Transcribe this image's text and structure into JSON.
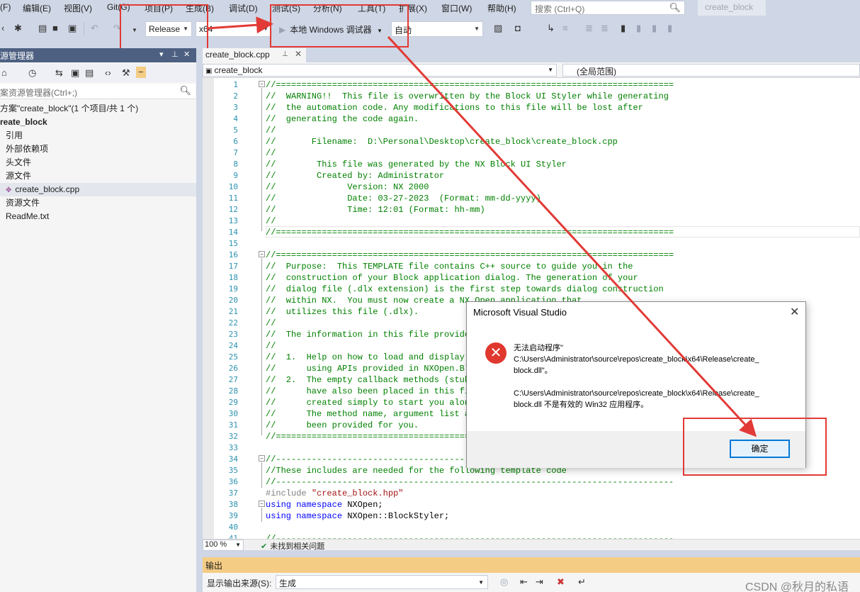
{
  "menu": [
    "(F)",
    "编辑(E)",
    "视图(V)",
    "Git(G)",
    "项目(P)",
    "生成(B)",
    "调试(D)",
    "测试(S)",
    "分析(N)",
    "工具(T)",
    "扩展(X)",
    "窗口(W)",
    "帮助(H)"
  ],
  "search": {
    "placeholder": "搜索 (Ctrl+Q)"
  },
  "project_title": "create_block",
  "toolbar": {
    "config": "Release",
    "platform": "x64",
    "run_label": "本地 Windows 调试器",
    "run_mode": "自动"
  },
  "solution_explorer": {
    "title": "源管理器",
    "search_placeholder": "案资源管理器(Ctrl+;)",
    "items": [
      {
        "label": "方案\"create_block\"(1 个项目/共 1 个)"
      },
      {
        "label": "reate_block"
      },
      {
        "label": "引用"
      },
      {
        "label": "外部依赖项"
      },
      {
        "label": "头文件"
      },
      {
        "label": "源文件"
      },
      {
        "label": "create_block.cpp"
      },
      {
        "label": "资源文件"
      },
      {
        "label": "ReadMe.txt"
      }
    ]
  },
  "editor": {
    "tab": "create_block.cpp",
    "nav_left": "create_block",
    "nav_right": "(全局范围)",
    "line_numbers": [
      "1",
      "2",
      "3",
      "4",
      "5",
      "6",
      "7",
      "8",
      "9",
      "10",
      "11",
      "12",
      "13",
      "14",
      "15",
      "16",
      "17",
      "18",
      "19",
      "20",
      "21",
      "22",
      "23",
      "24",
      "25",
      "26",
      "27",
      "28",
      "29",
      "30",
      "31",
      "32",
      "33",
      "34",
      "35",
      "36",
      "37",
      "38",
      "39",
      "40",
      "41"
    ],
    "lines": {
      "l1": "//==============================================================================",
      "l2": "//  WARNING!!  This file is overwritten by the Block UI Styler while generating",
      "l3": "//  the automation code. Any modifications to this file will be lost after",
      "l4": "//  generating the code again.",
      "l5": "//",
      "l6": "//       Filename:  D:\\Personal\\Desktop\\create_block\\create_block.cpp",
      "l7": "//",
      "l8": "//        This file was generated by the NX Block UI Styler",
      "l9": "//        Created by: Administrator",
      "l10": "//              Version: NX 2000",
      "l11": "//              Date: 03-27-2023  (Format: mm-dd-yyyy)",
      "l12": "//              Time: 12:01 (Format: hh-mm)",
      "l13": "//",
      "l14": "//==============================================================================",
      "l15": "",
      "l16": "//==============================================================================",
      "l17": "//  Purpose:  This TEMPLATE file contains C++ source to guide you in the",
      "l18": "//  construction of your Block application dialog. The generation of your",
      "l19": "//  dialog file (.dlx extension) is the first step towards dialog construction",
      "l20": "//  within NX.  You must now create a NX Open application that",
      "l21": "//  utilizes this file (.dlx).",
      "l22": "//",
      "l23": "//  The information in this file provide",
      "l24": "//",
      "l25": "//  1.  Help on how to load and display y",
      "l26": "//      using APIs provided in NXOpen.Blo",
      "l27": "//  2.  The empty callback methods (stub",
      "l28": "//      have also been placed in this fil",
      "l29": "//      created simply to start you along",
      "l30": "//      The method name, argument list an",
      "l31": "//      been provided for you.",
      "l32": "//==============================================================================",
      "l33": "",
      "l34": "//------------------------------------------------------------------------------",
      "l35": "//These includes are needed for the following template code",
      "l36": "//------------------------------------------------------------------------------",
      "l37_pp": "#include ",
      "l37_str": "\"create_block.hpp\"",
      "l38_kw": "using namespace ",
      "l38_rest": "NXOpen;",
      "l39_kw": "using namespace ",
      "l39_rest": "NXOpen::BlockStyler;",
      "l40": "",
      "l41": "//------------------------------------------------------------------------------"
    },
    "zoom": "100 %",
    "issues": "未找到相关问题"
  },
  "output": {
    "title": "输出",
    "source_label": "显示输出来源(S):",
    "source_value": "生成",
    "watermark": "CSDN @秋月的私语"
  },
  "dialog": {
    "title": "Microsoft Visual Studio",
    "msg1": "无法启动程序\"",
    "msg2": "C:\\Users\\Administrator\\source\\repos\\create_block\\x64\\Release\\create_",
    "msg3": "block.dll\"。",
    "msg4": "C:\\Users\\Administrator\\source\\repos\\create_block\\x64\\Release\\create_",
    "msg5": "block.dll 不是有效的 Win32 应用程序。",
    "ok": "确定"
  },
  "colors": {
    "annotation_red": "#e23a36",
    "accent": "#0078d7",
    "error": "#e0382e"
  }
}
